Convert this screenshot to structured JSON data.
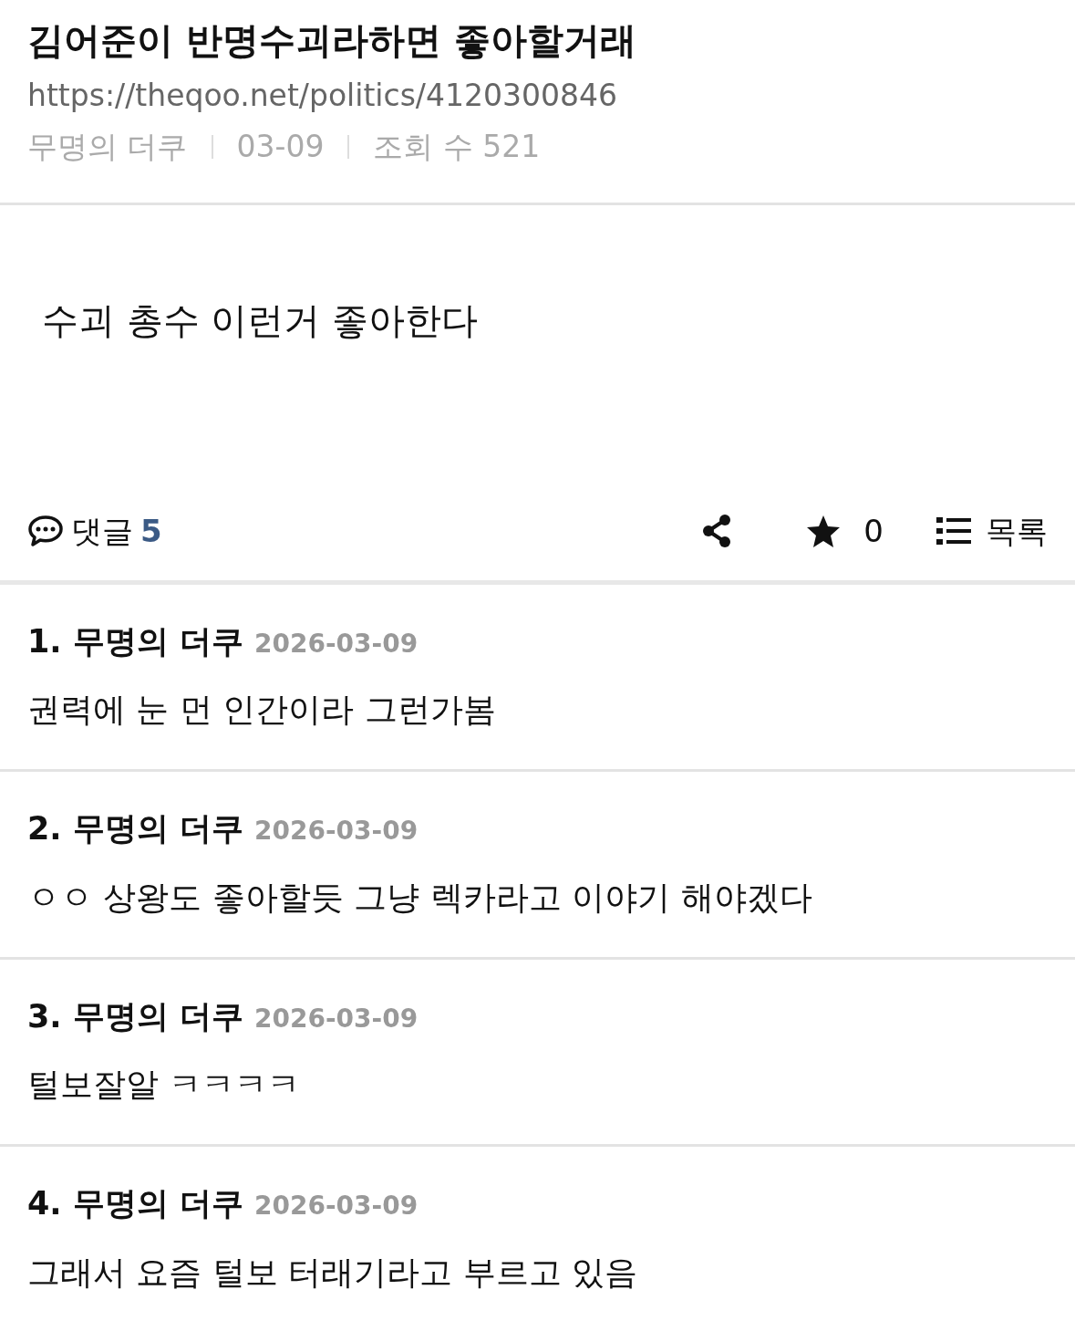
{
  "post": {
    "title": "김어준이 반명수괴라하면 좋아할거래",
    "url": "https://theqoo.net/politics/4120300846",
    "meta": [
      "무명의 더쿠",
      "03-09",
      "조회 수 521"
    ],
    "body": "수괴 총수 이런거 좋아한다"
  },
  "actions": {
    "comments_label": "댓글",
    "comment_count": "5",
    "favorite_count": "0",
    "list_label": "목록"
  },
  "comments": [
    {
      "heading": "1. 무명의 더쿠",
      "date": "2026-03-09",
      "text": "권력에 눈 먼 인간이라 그런가봄"
    },
    {
      "heading": "2. 무명의 더쿠",
      "date": "2026-03-09",
      "text": "ㅇㅇ 상왕도 좋아할듯 그냥 렉카라고 이야기 해야겠다"
    },
    {
      "heading": "3. 무명의 더쿠",
      "date": "2026-03-09",
      "text": "털보잘알 ㅋㅋㅋㅋ"
    },
    {
      "heading": "4. 무명의 더쿠",
      "date": "2026-03-09",
      "text": "그래서 요즘 털보 터래기라고 부르고 있음"
    }
  ]
}
